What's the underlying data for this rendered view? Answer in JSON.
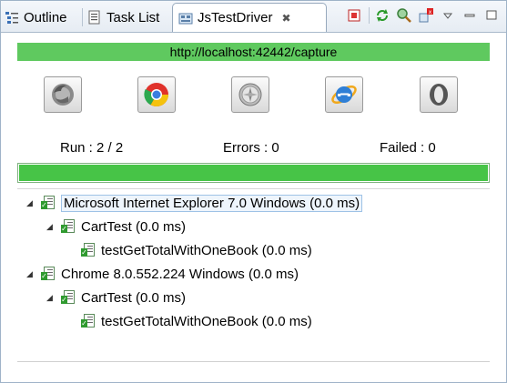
{
  "tabs": {
    "outline": "Outline",
    "task_list": "Task List",
    "jstestdriver": "JsTestDriver"
  },
  "server_url": "http://localhost:42442/capture",
  "browsers": [
    "firefox-icon",
    "chrome-icon",
    "safari-icon",
    "internet-explorer-icon",
    "opera-icon"
  ],
  "stats": {
    "run": "Run : 2 / 2",
    "errors": "Errors : 0",
    "failed": "Failed : 0"
  },
  "progress": 1.0,
  "tree": [
    {
      "label": "Microsoft Internet Explorer 7.0 Windows (0.0 ms)"
    },
    {
      "label": "CartTest (0.0 ms)"
    },
    {
      "label": "testGetTotalWithOneBook (0.0 ms)"
    },
    {
      "label": "Chrome 8.0.552.224 Windows (0.0 ms)"
    },
    {
      "label": "CartTest (0.0 ms)"
    },
    {
      "label": "testGetTotalWithOneBook (0.0 ms)"
    }
  ],
  "colors": {
    "pass_green": "#47c447",
    "url_green": "#5fc95f"
  }
}
